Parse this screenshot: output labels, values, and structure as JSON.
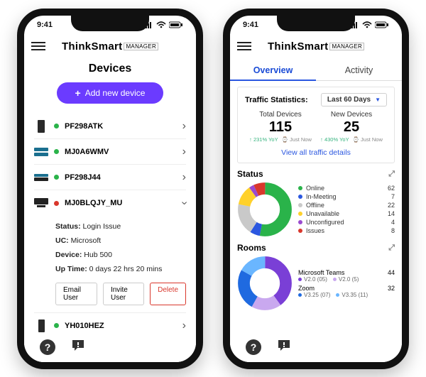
{
  "statusbar": {
    "time": "9:41"
  },
  "brand": {
    "bold": "ThinkSmart",
    "tag": "MANAGER"
  },
  "devicesScreen": {
    "title": "Devices",
    "addLabel": "Add new device",
    "rows": [
      {
        "name": "PF298ATK",
        "color": "#2ab34a"
      },
      {
        "name": "MJ0A6WMV",
        "color": "#2ab34a"
      },
      {
        "name": "PF298J44",
        "color": "#2ab34a"
      },
      {
        "name": "MJ0BLQJY_MU",
        "color": "#d9372c",
        "expanded": true
      },
      {
        "name": "YH010HEZ",
        "color": "#2ab34a"
      }
    ],
    "detail": {
      "statusK": "Status:",
      "statusV": "Login Issue",
      "ucK": "UC:",
      "ucV": "Microsoft",
      "deviceK": "Device:",
      "deviceV": "Hub 500",
      "uptimeK": "Up Time:",
      "uptimeV": "0 days 22 hrs 20 mins",
      "emailBtn": "Email User",
      "inviteBtn": "Invite User",
      "deleteBtn": "Delete"
    }
  },
  "overviewScreen": {
    "tabs": {
      "overview": "Overview",
      "activity": "Activity"
    },
    "traffic": {
      "label": "Traffic Statistics:",
      "range": "Last 60 Days",
      "totalLabel": "Total Devices",
      "totalValue": "115",
      "newLabel": "New Devices",
      "newValue": "25",
      "totalYoY": "231% YoY",
      "newYoY": "430% YoY",
      "justNow": "Just Now",
      "link": "View all traffic details"
    },
    "status": {
      "title": "Status",
      "items": [
        {
          "label": "Online",
          "value": "62",
          "color": "#2ab34a"
        },
        {
          "label": "In-Meeting",
          "value": "7",
          "color": "#2b57e0"
        },
        {
          "label": "Offline",
          "value": "22",
          "color": "#c9c9c9"
        },
        {
          "label": "Unavailable",
          "value": "14",
          "color": "#ffd12b"
        },
        {
          "label": "Unconfigured",
          "value": "4",
          "color": "#9a4bcf"
        },
        {
          "label": "Issues",
          "value": "8",
          "color": "#d9372c"
        }
      ]
    },
    "rooms": {
      "title": "Rooms",
      "items": [
        {
          "label": "Microsoft Teams",
          "value": "44",
          "subs": [
            {
              "label": "V2.0",
              "value": "(05)",
              "color": "#7a3fd6"
            },
            {
              "label": "V2.0",
              "value": "(5)",
              "color": "#c9a8ef"
            }
          ]
        },
        {
          "label": "Zoom",
          "value": "32",
          "subs": [
            {
              "label": "V3.25",
              "value": "(07)",
              "color": "#1f6ae0"
            },
            {
              "label": "V3.35",
              "value": "(11)",
              "color": "#6ab6ff"
            }
          ]
        }
      ]
    }
  }
}
